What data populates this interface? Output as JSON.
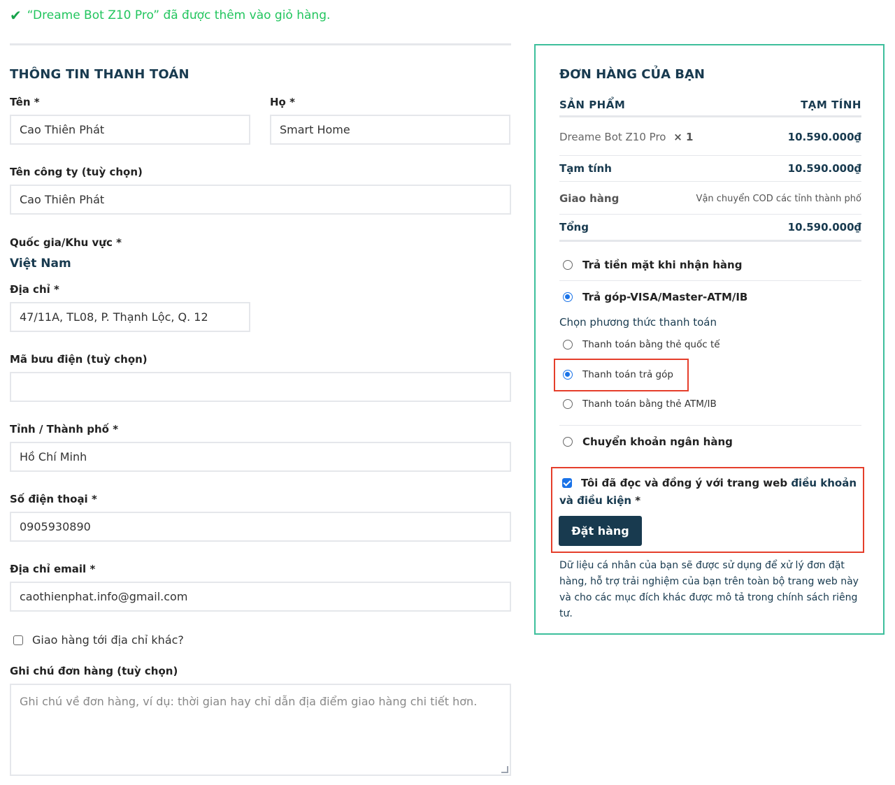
{
  "notice": {
    "icon": "check-icon",
    "text": "“Dreame Bot Z10 Pro” đã được thêm vào giỏ hàng."
  },
  "billing": {
    "title": "THÔNG TIN THANH TOÁN",
    "first_name": {
      "label": "Tên",
      "value": "Cao Thiên Phát"
    },
    "last_name": {
      "label": "Họ",
      "value": "Smart Home"
    },
    "company": {
      "label": "Tên công ty (tuỳ chọn)",
      "value": "Cao Thiên Phát"
    },
    "country": {
      "label": "Quốc gia/Khu vực",
      "value": "Việt Nam"
    },
    "address": {
      "label": "Địa chỉ",
      "value": "47/11A, TL08, P. Thạnh Lộc, Q. 12"
    },
    "postcode": {
      "label": "Mã bưu điện (tuỳ chọn)",
      "value": ""
    },
    "city": {
      "label": "Tỉnh / Thành phố",
      "value": "Hồ Chí Minh"
    },
    "phone": {
      "label": "Số điện thoại",
      "value": "0905930890"
    },
    "email": {
      "label": "Địa chỉ email",
      "value": "caothienphat.info@gmail.com"
    },
    "ship_different": {
      "label": "Giao hàng tới địa chỉ khác?",
      "checked": false
    },
    "notes": {
      "label": "Ghi chú đơn hàng (tuỳ chọn)",
      "placeholder": "Ghi chú về đơn hàng, ví dụ: thời gian hay chỉ dẫn địa điểm giao hàng chi tiết hơn."
    },
    "required_mark": "*"
  },
  "order": {
    "title": "ĐƠN HÀNG CỦA BẠN",
    "col_product": "SẢN PHẨM",
    "col_subtotal": "TẠM TÍNH",
    "item_name": "Dreame Bot Z10 Pro",
    "item_qty": "× 1",
    "item_price": "10.590.000₫",
    "subtotal_label": "Tạm tính",
    "subtotal_value": "10.590.000₫",
    "shipping_label": "Giao hàng",
    "shipping_value": "Vận chuyển COD các tỉnh thành phố",
    "total_label": "Tổng",
    "total_value": "10.590.000₫"
  },
  "payment": {
    "cod": "Trả tiền mặt khi nhận hàng",
    "installment": "Trả góp-VISA/Master-ATM/IB",
    "choose_method": "Chọn phương thức thanh toán",
    "opt_international": "Thanh toán bằng thẻ quốc tế",
    "opt_installment": "Thanh toán trả góp",
    "opt_atm": "Thanh toán bằng thẻ ATM/IB",
    "bank_transfer": "Chuyển khoản ngân hàng"
  },
  "terms": {
    "prefix": "Tôi đã đọc và đồng ý với trang web ",
    "link": "điều khoản và điều kiện",
    "suffix": " *",
    "checked": true
  },
  "place_order": "Đặt hàng",
  "privacy": "Dữ liệu cá nhân của bạn sẽ được sử dụng để xử lý đơn đặt hàng, hỗ trợ trải nghiệm của bạn trên toàn bộ trang web này và cho các mục đích khác được mô tả trong chính sách riêng tư.",
  "colors": {
    "accent": "#183a4f",
    "success": "#22c55e",
    "border_green": "#3dbf9c",
    "highlight_red": "#e53e2b",
    "radio_blue": "#1a73e8"
  }
}
